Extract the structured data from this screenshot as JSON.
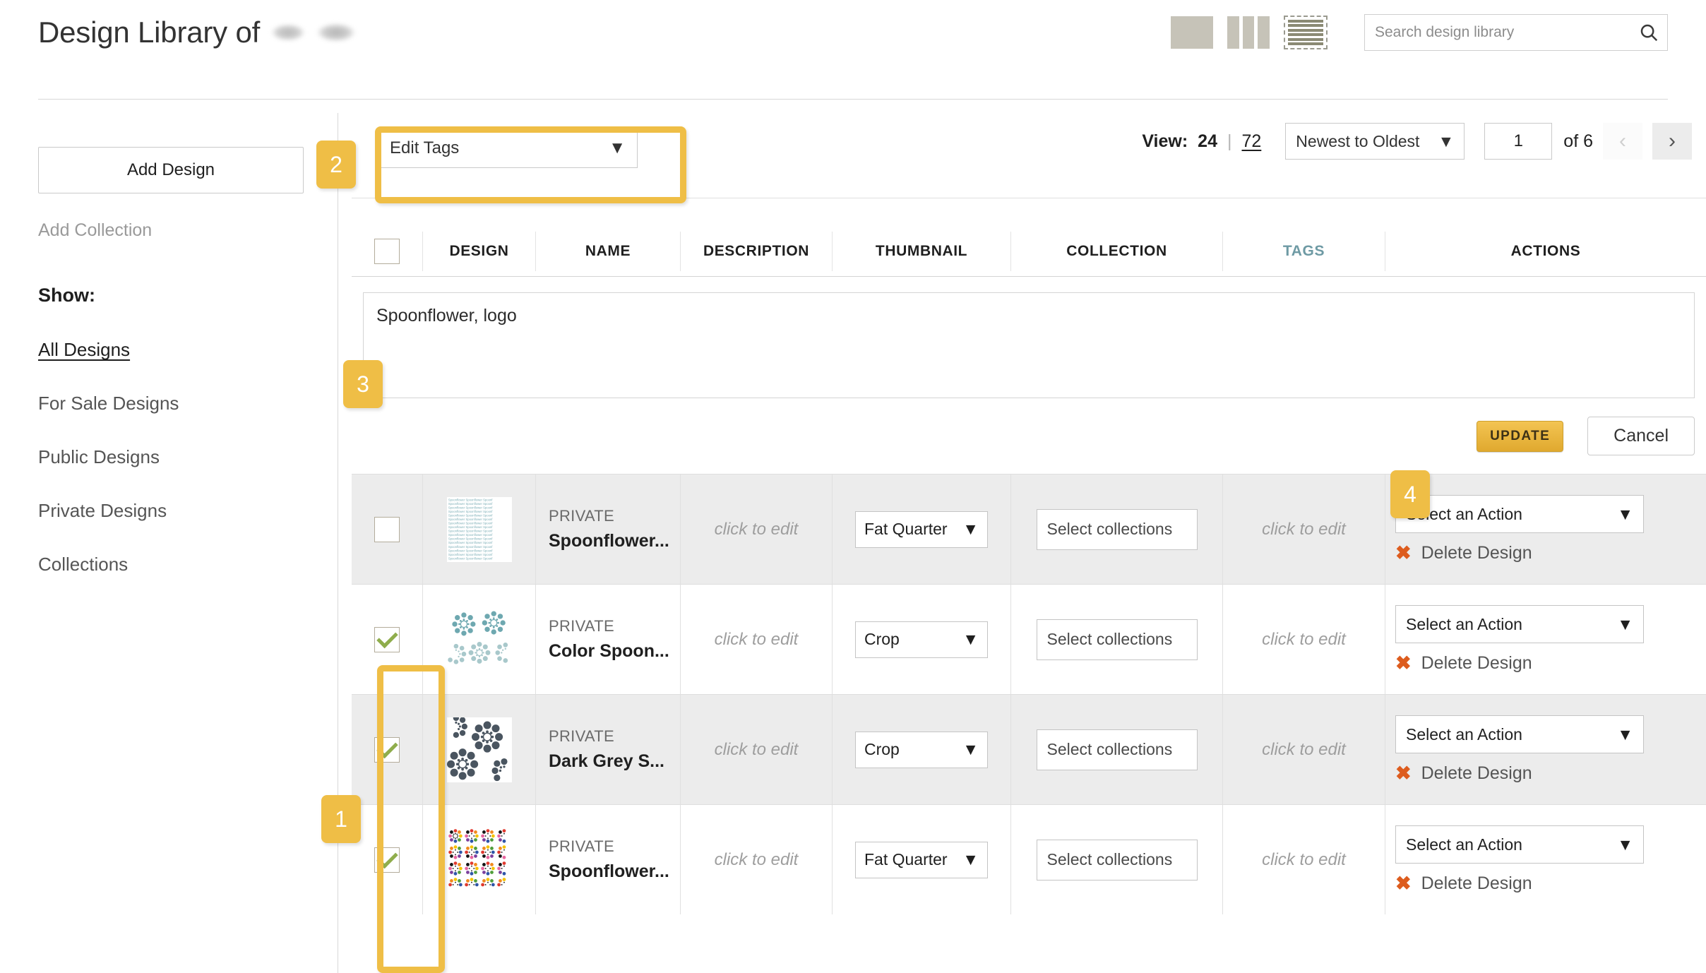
{
  "header": {
    "title_prefix": "Design Library of",
    "redacted_name": "",
    "view_icons": [
      {
        "name": "grid-single-view-icon",
        "label": "Single large view"
      },
      {
        "name": "grid-columns-view-icon",
        "label": "Column view"
      },
      {
        "name": "list-rows-view-icon",
        "label": "List view",
        "selected": true
      }
    ],
    "search": {
      "placeholder": "Search design library",
      "value": "",
      "icon": "search-icon"
    }
  },
  "sidebar": {
    "add_design_label": "Add Design",
    "add_collection_label": "Add Collection",
    "show_heading": "Show:",
    "nav": [
      {
        "label": "All Designs",
        "active": true
      },
      {
        "label": "For Sale Designs",
        "active": false
      },
      {
        "label": "Public Designs",
        "active": false
      },
      {
        "label": "Private Designs",
        "active": false
      },
      {
        "label": "Collections",
        "active": false
      }
    ]
  },
  "toolbar": {
    "bulk_action_label": "Edit Tags",
    "caret_icon": "chevron-down-icon",
    "view_label": "View:",
    "view_count_current": "24",
    "view_separator": "|",
    "view_count_alt": "72",
    "sort_label": "Newest to Oldest",
    "page_value": "1",
    "page_of": "of 6",
    "prev_icon": "chevron-left-icon",
    "next_icon": "chevron-right-icon"
  },
  "table": {
    "columns": [
      {
        "label": "",
        "name": "select-all"
      },
      {
        "label": "DESIGN",
        "name": "design"
      },
      {
        "label": "NAME",
        "name": "name"
      },
      {
        "label": "DESCRIPTION",
        "name": "description"
      },
      {
        "label": "THUMBNAIL",
        "name": "thumbnail"
      },
      {
        "label": "COLLECTION",
        "name": "collection"
      },
      {
        "label": "TAGS",
        "name": "tags",
        "highlight": true
      },
      {
        "label": "ACTIONS",
        "name": "actions"
      }
    ],
    "tag_editor": {
      "value": "Spoonflower, logo",
      "update_label": "UPDATE",
      "cancel_label": "Cancel"
    },
    "rows": [
      {
        "checked": false,
        "shaded": true,
        "privacy": "PRIVATE",
        "name": "Spoonflower...",
        "description": "click to edit",
        "thumbnail": "Fat Quarter",
        "collection_placeholder": "Select collections",
        "tags": "click to edit",
        "action": "Select an Action",
        "delete_label": "Delete Design",
        "swatch": "text-tile"
      },
      {
        "checked": true,
        "shaded": false,
        "privacy": "PRIVATE",
        "name": "Color Spoon...",
        "description": "click to edit",
        "thumbnail": "Crop",
        "collection_placeholder": "Select collections",
        "tags": "click to edit",
        "action": "Select an Action",
        "delete_label": "Delete Design",
        "swatch": "teal-flowers"
      },
      {
        "checked": true,
        "shaded": true,
        "privacy": "PRIVATE",
        "name": "Dark Grey S...",
        "description": "click to edit",
        "thumbnail": "Crop",
        "collection_placeholder": "Select collections",
        "tags": "click to edit",
        "action": "Select an Action",
        "delete_label": "Delete Design",
        "swatch": "grey-flowers"
      },
      {
        "checked": true,
        "shaded": false,
        "privacy": "PRIVATE",
        "name": "Spoonflower...",
        "description": "click to edit",
        "thumbnail": "Fat Quarter",
        "collection_placeholder": "Select collections",
        "tags": "click to edit",
        "action": "Select an Action",
        "delete_label": "Delete Design",
        "swatch": "multicolor-flowers"
      }
    ]
  },
  "annotations": {
    "badges": [
      {
        "id": "1",
        "target": "row-checkboxes"
      },
      {
        "id": "2",
        "target": "bulk-action-select"
      },
      {
        "id": "3",
        "target": "tag-textarea"
      },
      {
        "id": "4",
        "target": "update-button"
      }
    ],
    "color": "#efbe46"
  }
}
